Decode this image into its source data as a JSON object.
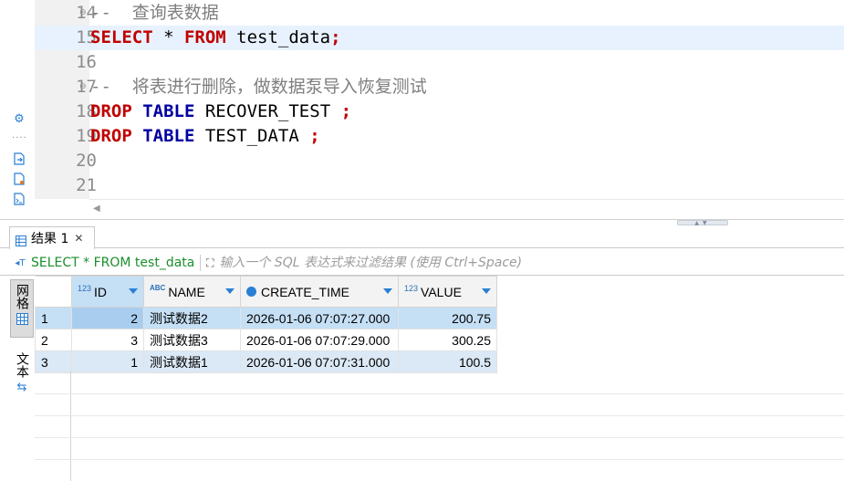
{
  "editor": {
    "lines": [
      {
        "num": "14",
        "fold": true,
        "current": false,
        "segments": [
          {
            "t": "cmt",
            "v": "--  查询表数据"
          }
        ]
      },
      {
        "num": "15",
        "fold": false,
        "current": true,
        "segments": [
          {
            "t": "kw-red",
            "v": "SELECT"
          },
          {
            "t": "plain",
            "v": " * "
          },
          {
            "t": "kw-red",
            "v": "FROM"
          },
          {
            "t": "plain",
            "v": " test_data"
          },
          {
            "t": "semi",
            "v": ";"
          }
        ]
      },
      {
        "num": "16",
        "fold": false,
        "current": false,
        "segments": []
      },
      {
        "num": "17",
        "fold": true,
        "current": false,
        "segments": [
          {
            "t": "cmt",
            "v": "--  将表进行删除，做数据泵导入恢复测试"
          }
        ]
      },
      {
        "num": "18",
        "fold": false,
        "current": false,
        "segments": [
          {
            "t": "kw-red",
            "v": "DROP"
          },
          {
            "t": "plain",
            "v": " "
          },
          {
            "t": "kw-blue",
            "v": "TABLE"
          },
          {
            "t": "plain",
            "v": " RECOVER_TEST "
          },
          {
            "t": "semi",
            "v": ";"
          }
        ]
      },
      {
        "num": "19",
        "fold": false,
        "current": false,
        "segments": [
          {
            "t": "kw-red",
            "v": "DROP"
          },
          {
            "t": "plain",
            "v": " "
          },
          {
            "t": "kw-blue",
            "v": "TABLE"
          },
          {
            "t": "plain",
            "v": " TEST_DATA "
          },
          {
            "t": "semi",
            "v": ";"
          }
        ]
      },
      {
        "num": "20",
        "fold": false,
        "current": false,
        "segments": []
      },
      {
        "num": "21",
        "fold": false,
        "current": false,
        "segments": []
      }
    ]
  },
  "results": {
    "tab_label": "结果 1",
    "tab_close": "✕",
    "query_text": "SELECT * FROM test_data",
    "filter_placeholder": "输入一个 SQL 表达式来过滤结果 (使用 Ctrl+Space)",
    "side_tab_grid": "网格",
    "side_tab_text": "文本",
    "columns": [
      {
        "label": "ID",
        "type": "123"
      },
      {
        "label": "NAME",
        "type": "ABC"
      },
      {
        "label": "CREATE_TIME",
        "type": "clock"
      },
      {
        "label": "VALUE",
        "type": "123"
      }
    ],
    "rows": [
      {
        "rownum": "1",
        "id": "2",
        "name": "测试数据2",
        "create_time": "2026-01-06 07:07:27.000",
        "value": "200.75"
      },
      {
        "rownum": "2",
        "id": "3",
        "name": "测试数据3",
        "create_time": "2026-01-06 07:07:29.000",
        "value": "300.25"
      },
      {
        "rownum": "3",
        "id": "1",
        "name": "测试数据1",
        "create_time": "2026-01-06 07:07:31.000",
        "value": "100.5"
      }
    ]
  },
  "colors": {
    "keyword_red": "#c00000",
    "keyword_blue": "#0000a0",
    "comment_gray": "#7f7f7f",
    "query_green": "#1a8f2c",
    "selection_blue": "#c5dff5"
  },
  "icons": {
    "strip": [
      "gear-icon",
      "export-icon",
      "file-icon",
      "xml-file-icon"
    ],
    "tab": "grid-icon",
    "filter_query": "sql-query-icon",
    "filter_expand": "expand-icon",
    "side_grid": "table-grid-icon",
    "side_text": "text-filter-icon"
  }
}
